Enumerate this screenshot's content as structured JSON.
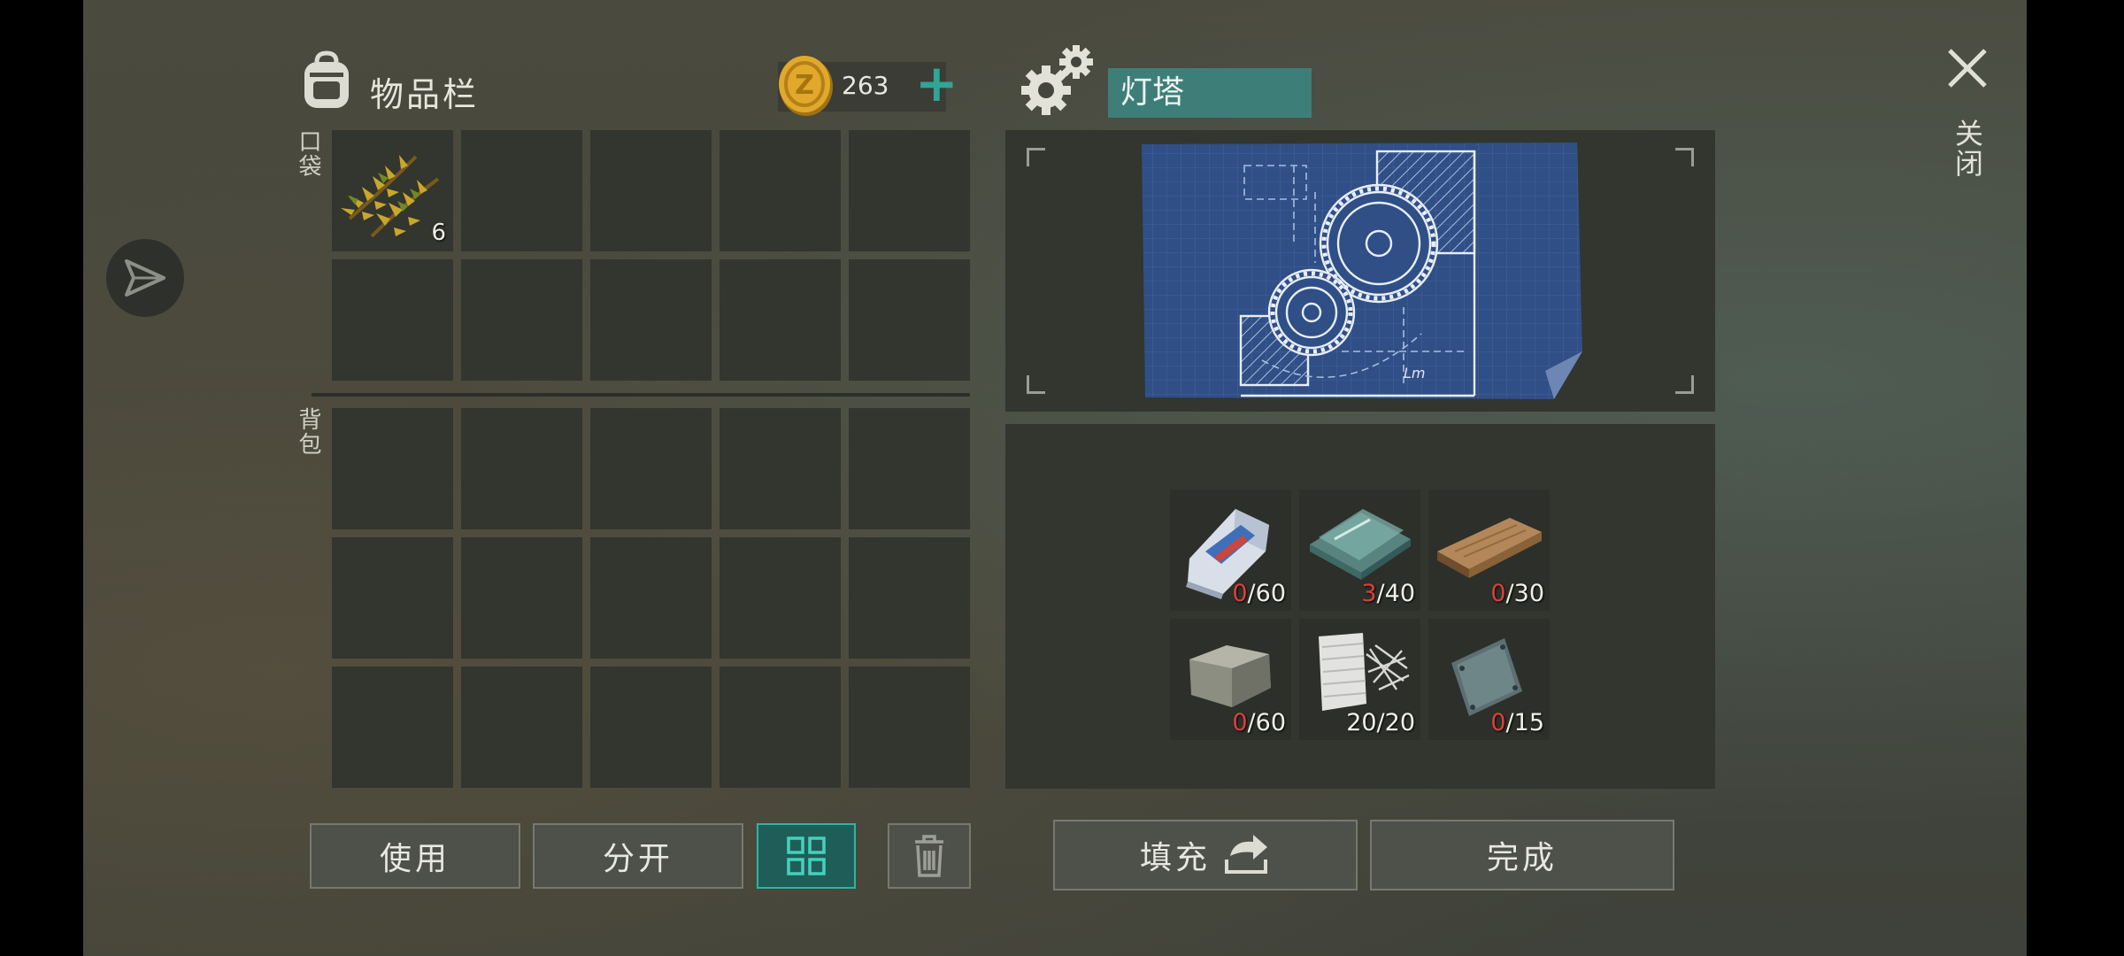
{
  "inventory": {
    "title": "物品栏",
    "currency_amount": "263",
    "add_label": "+",
    "pocket_label": "口袋",
    "backpack_label": "背包",
    "pocket_slots": [
      {
        "item": "fir-branches",
        "count": "6"
      }
    ]
  },
  "crafting": {
    "title": "灯塔",
    "materials": [
      {
        "name": "cement-bag",
        "have": "0",
        "need": "/60"
      },
      {
        "name": "glass-sheets",
        "have": "3",
        "need": "/40"
      },
      {
        "name": "wooden-plank",
        "have": "0",
        "need": "/30"
      },
      {
        "name": "stone",
        "have": "0",
        "need": "/60"
      },
      {
        "name": "cloth-and-wires",
        "have": "20/20",
        "need": ""
      },
      {
        "name": "metal-plate",
        "have": "0",
        "need": "/15"
      }
    ]
  },
  "buttons": {
    "use": "使用",
    "split": "分开",
    "fill": "填充",
    "done": "完成"
  },
  "close_label": "关闭",
  "colors": {
    "accent_teal": "#2a9d8f",
    "title_box": "#3d7f78",
    "missing_red": "#d8423a"
  }
}
